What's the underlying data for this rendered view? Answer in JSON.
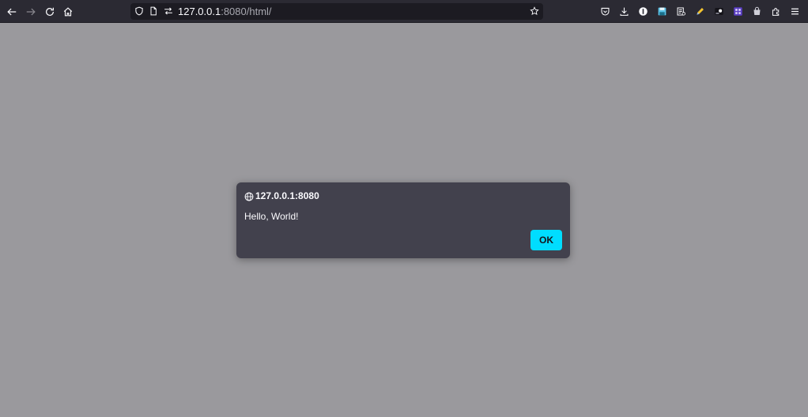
{
  "browser": {
    "url_host": "127.0.0.1",
    "url_rest": ":8080/html/",
    "icons": {
      "back": "arrow-left-icon",
      "forward": "arrow-right-icon",
      "reload": "reload-icon",
      "home": "home-icon",
      "tracking": "shield-icon",
      "page": "page-icon",
      "permissions": "permissions-icon",
      "bookmark": "star-icon"
    },
    "extensions": [
      "pocket-icon",
      "download-icon",
      "extension-i-icon",
      "save-icon",
      "reader-icon",
      "pencil-icon",
      "extension-dark-icon",
      "extension-purple-icon",
      "extension-bag-icon",
      "extensions-puzzle-icon",
      "menu-icon"
    ]
  },
  "dialog": {
    "origin": "127.0.0.1:8080",
    "message": "Hello, World!",
    "ok_label": "OK"
  },
  "colors": {
    "page_background": "#9a999d",
    "toolbar": "#2b2a33",
    "dialog": "#42414d",
    "accent": "#00ddff"
  }
}
